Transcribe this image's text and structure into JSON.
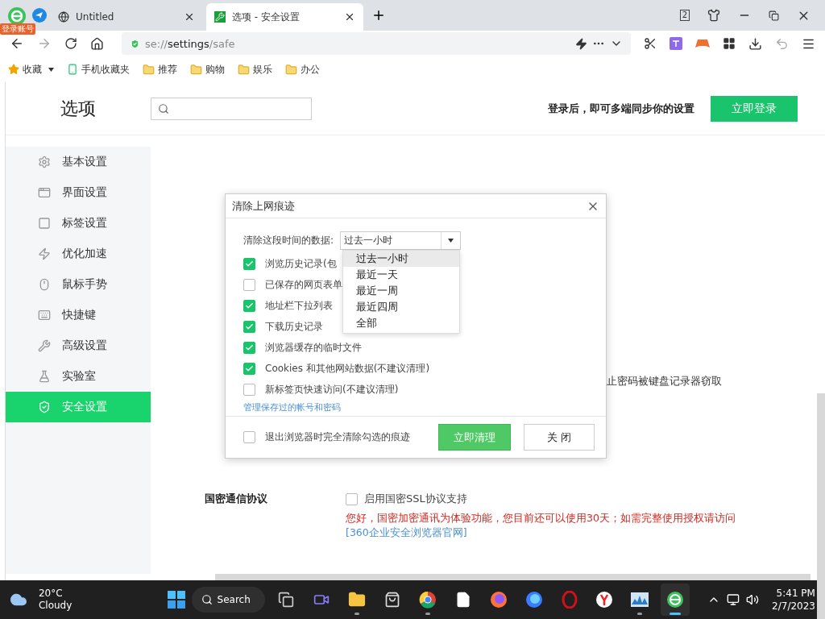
{
  "browser": {
    "account_badge": "登录账号",
    "tabs": [
      {
        "title": "Untitled",
        "selected": false
      },
      {
        "title": "选项 - 安全设置",
        "selected": true
      }
    ],
    "tab_count": "2",
    "address": {
      "scheme": "se://",
      "host": "settings",
      "path": "/safe"
    },
    "bookmarks": [
      {
        "kind": "star",
        "label": "收藏"
      },
      {
        "kind": "phone",
        "label": "手机收藏夹"
      },
      {
        "kind": "folder",
        "label": "推荐"
      },
      {
        "kind": "folder",
        "label": "购物"
      },
      {
        "kind": "folder",
        "label": "娱乐"
      },
      {
        "kind": "folder",
        "label": "办公"
      }
    ]
  },
  "settings": {
    "title": "选项",
    "login_prompt": "登录后，即可多端同步你的设置",
    "login_button": "立即登录",
    "sidebar": [
      {
        "kind": "gear",
        "label": "基本设置",
        "selected": false
      },
      {
        "kind": "window",
        "label": "界面设置",
        "selected": false
      },
      {
        "kind": "tab",
        "label": "标签设置",
        "selected": false
      },
      {
        "kind": "bolt",
        "label": "优化加速",
        "selected": false
      },
      {
        "kind": "mouse",
        "label": "鼠标手势",
        "selected": false
      },
      {
        "kind": "key",
        "label": "快捷键",
        "selected": false
      },
      {
        "kind": "wrench",
        "label": "高级设置",
        "selected": false
      },
      {
        "kind": "flask",
        "label": "实验室",
        "selected": false
      },
      {
        "kind": "shield",
        "label": "安全设置",
        "selected": true
      }
    ],
    "partial_text": "止密码被键盘记录器窃取",
    "gm_section": {
      "title": "国密通信协议",
      "option": {
        "label": "启用国密SSL协议支持",
        "checked": false
      },
      "notice": "您好，国密加密通讯为体验功能，您目前还可以使用30天；如需完整使用授权请访问",
      "link": "[360企业安全浏览器官网]"
    }
  },
  "dialog": {
    "title": "清除上网痕迹",
    "range_label": "清除这段时间的数据:",
    "range_value": "过去一小时",
    "range_options": [
      {
        "label": "过去一小时",
        "selected": true
      },
      {
        "label": "最近一天",
        "selected": false
      },
      {
        "label": "最近一周",
        "selected": false
      },
      {
        "label": "最近四周",
        "selected": false
      },
      {
        "label": "全部",
        "selected": false
      }
    ],
    "items": [
      {
        "label": "浏览历史记录(包",
        "checked": true
      },
      {
        "label": "已保存的网页表单",
        "checked": false
      },
      {
        "label": "地址栏下拉列表",
        "checked": true
      },
      {
        "label": "下载历史记录",
        "checked": true
      },
      {
        "label": "浏览器缓存的临时文件",
        "checked": true
      },
      {
        "label": "Cookies 和其他网站数据(不建议清理)",
        "checked": true
      },
      {
        "label": "新标签页快速访问(不建议清理)",
        "checked": false
      }
    ],
    "manage_link": "管理保存过的帐号和密码",
    "clear_on_exit": {
      "label": "退出浏览器时完全清除勾选的痕迹",
      "checked": false
    },
    "buttons": [
      {
        "kind": "primary",
        "label": "立即清理"
      },
      {
        "kind": "secondary",
        "label": "关 闭"
      }
    ]
  },
  "taskbar": {
    "temperature": "20°C",
    "condition": "Cloudy",
    "search": "Search",
    "apps": [
      {
        "kind": "taskview",
        "running": false,
        "selected": false
      },
      {
        "kind": "chat",
        "running": false,
        "selected": false
      },
      {
        "kind": "folder",
        "running": true,
        "selected": false
      },
      {
        "kind": "store",
        "running": false,
        "selected": false
      },
      {
        "kind": "chrome",
        "running": true,
        "selected": false
      },
      {
        "kind": "file",
        "running": false,
        "selected": false
      },
      {
        "kind": "firefox",
        "running": false,
        "selected": false
      },
      {
        "kind": "firefoxdev",
        "running": false,
        "selected": false
      },
      {
        "kind": "opera",
        "running": false,
        "selected": false
      },
      {
        "kind": "yandex",
        "running": false,
        "selected": false
      },
      {
        "kind": "monitor",
        "running": true,
        "selected": false
      },
      {
        "kind": "browser360",
        "running": true,
        "selected": true
      }
    ],
    "time": "5:41 PM",
    "date": "2/7/2023"
  }
}
